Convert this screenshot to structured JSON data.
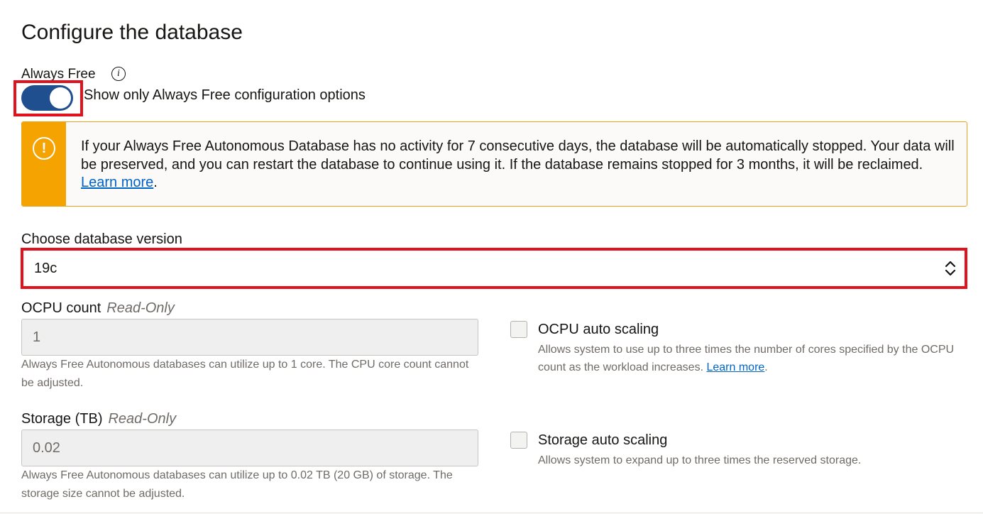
{
  "page": {
    "title": "Configure the database"
  },
  "always_free": {
    "label": "Always Free",
    "info_icon": "info-icon",
    "toggle_on": true,
    "toggle_label": "Show only Always Free configuration options"
  },
  "notice": {
    "icon": "warning-icon",
    "text": "If your Always Free Autonomous Database has no activity for 7 consecutive days, the database will be automatically stopped. Your data will be preserved, and you can restart the database to continue using it. If the database remains stopped for 3 months, it will be reclaimed. ",
    "link": "Learn more",
    "trail": ".",
    "accent_color": "#f5a300"
  },
  "db_version": {
    "label": "Choose database version",
    "value": "19c"
  },
  "ocpu": {
    "label": "OCPU count",
    "readonly": "Read-Only",
    "value": "1",
    "help": "Always Free Autonomous databases can utilize up to 1 core. The CPU core count cannot be adjusted."
  },
  "ocpu_autoscale": {
    "label": "OCPU auto scaling",
    "checked": false,
    "help": "Allows system to use up to three times the number of cores specified by the OCPU count as the workload increases. ",
    "link": "Learn more",
    "trail": "."
  },
  "storage": {
    "label": "Storage (TB)",
    "readonly": "Read-Only",
    "value": "0.02",
    "help": "Always Free Autonomous databases can utilize up to 0.02 TB (20 GB) of storage. The storage size cannot be adjusted."
  },
  "storage_autoscale": {
    "label": "Storage auto scaling",
    "checked": false,
    "help": "Allows system to expand up to three times the reserved storage."
  },
  "colors": {
    "toggle_on": "#1f4f8f",
    "highlight": "#e0121d",
    "link": "#0064c7"
  }
}
